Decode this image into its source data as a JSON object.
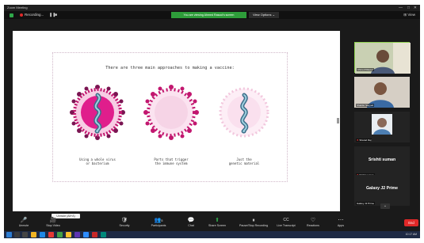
{
  "window": {
    "title": "Zoom Meeting",
    "controls": [
      "—",
      "□",
      "✕"
    ]
  },
  "topbar": {
    "recording_label": "Recording...",
    "recording_controls": [
      "❚❚",
      "■"
    ],
    "share_banner": "You are viewing Ahmed Rasool's screen",
    "view_options": "View Options ⌄",
    "view_button": "⊞ View"
  },
  "slide": {
    "title": "There are three main approaches to making a vaccine:",
    "captions": [
      {
        "line1": "Using a whole virus",
        "line2": "or bacterium"
      },
      {
        "line1": "Parts that trigger",
        "line2": "the immune system"
      },
      {
        "line1": "Just the",
        "line2": "genetic material"
      }
    ]
  },
  "participants": [
    {
      "name": "Ahmed Rasool"
    },
    {
      "name": "Shabbir Sayyed"
    },
    {
      "name": "Sharad Raj"
    },
    {
      "name": "Srishti suman",
      "big": "Srishti suman"
    },
    {
      "name": "Galaxy J2 Prime",
      "big": "Galaxy J2 Prime"
    }
  ],
  "toolbar": {
    "tooltip": "Unmute (Alt+A)",
    "items": [
      {
        "icon": "🎤",
        "label": "Unmute"
      },
      {
        "icon": "🎥",
        "label": "Stop Video"
      },
      {
        "icon": "🛡",
        "label": "Security"
      },
      {
        "icon": "👥",
        "label": "Participants",
        "count": "5"
      },
      {
        "icon": "💬",
        "label": "Chat"
      },
      {
        "icon": "⬆",
        "label": "Share Screen"
      },
      {
        "icon": "⏸",
        "label": "Pause/Stop Recording"
      },
      {
        "icon": "CC",
        "label": "Live Transcript"
      },
      {
        "icon": "♡",
        "label": "Reactions"
      },
      {
        "icon": "⋯",
        "label": "Apps"
      }
    ],
    "end_label": "End"
  },
  "taskbar": {
    "clock": "10:17 AM"
  },
  "colors": {
    "accent_green": "#2e9d3a",
    "end_red": "#e02828",
    "virus_pink": "#e01e8c",
    "virus_purple": "#7a1552"
  }
}
